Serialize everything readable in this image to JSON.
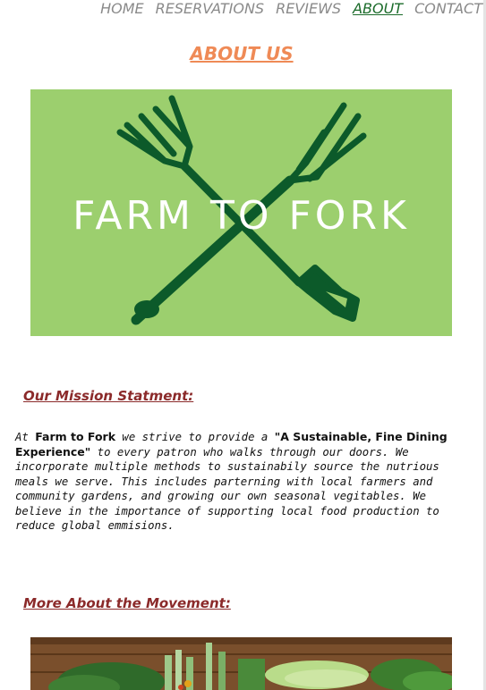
{
  "nav": {
    "items": [
      {
        "label": "HOME",
        "active": false
      },
      {
        "label": "RESERVATIONS",
        "active": false
      },
      {
        "label": "REVIEWS",
        "active": false
      },
      {
        "label": "ABOUT",
        "active": true
      },
      {
        "label": "CONTACT",
        "active": false
      }
    ]
  },
  "page": {
    "title": "ABOUT US"
  },
  "logo": {
    "text": "FARM TO FORK",
    "background_color": "#9ccf6e",
    "icon_color": "#0c5a2a"
  },
  "mission": {
    "heading": "Our Mission Statment:",
    "intro": "At ",
    "brand": "Farm to Fork",
    "middle": " we strive to provide a ",
    "quote": "\"A Sustainable, Fine Dining Experience\"",
    "rest": " to every patron who walks through our doors. We incorporate multiple methods to sustainabily source the nutrious meals we serve. This includes parterning with local farmers and community gardens, and growing our own seasonal vegitables. We believe in the importance of supporting local food production to reduce global emmisions."
  },
  "movement": {
    "heading": "More About the Movement:"
  },
  "colors": {
    "heading_color": "#8b2a2a",
    "title_color": "#ef8a56",
    "nav_active": "#1b6b2a",
    "nav_inactive": "#8a8a8a"
  }
}
